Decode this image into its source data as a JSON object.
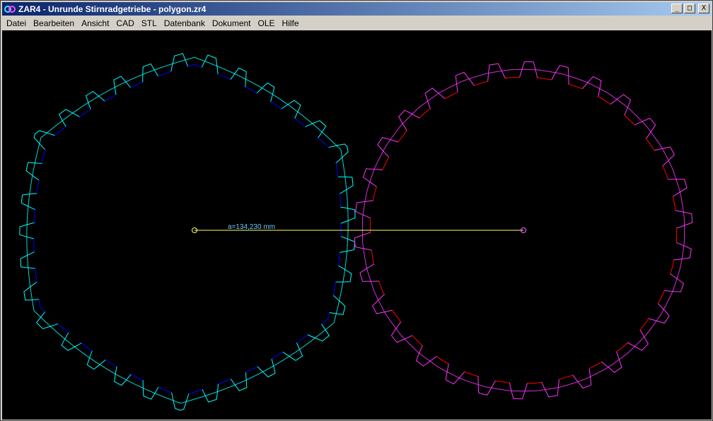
{
  "window": {
    "title": "ZAR4 - Unrunde Stirnradgetriebe  -  polygon.zr4",
    "controls": {
      "minimize": "_",
      "maximize": "□",
      "close": "X"
    }
  },
  "menu": {
    "items": [
      "Datei",
      "Bearbeiten",
      "Ansicht",
      "CAD",
      "STL",
      "Datenbank",
      "Dokument",
      "OLE",
      "Hilfe"
    ]
  },
  "canvas": {
    "background": "#000000",
    "distance_label": "a=134,230 mm",
    "center_line_color": "#ffff66",
    "gear1": {
      "teeth": 33,
      "flank_color": "#00ffff",
      "root_color": "#0000ff"
    },
    "gear2": {
      "teeth": 30,
      "flank_color": "#ff33ff",
      "root_color": "#ff0000"
    },
    "status_text": "· · · · · · · · · · · · · · · · · · · · · · · · · · · · · · · ·"
  },
  "icons": {
    "app": "app-icon",
    "minimize": "minimize-icon",
    "maximize": "maximize-icon",
    "close": "close-icon"
  }
}
